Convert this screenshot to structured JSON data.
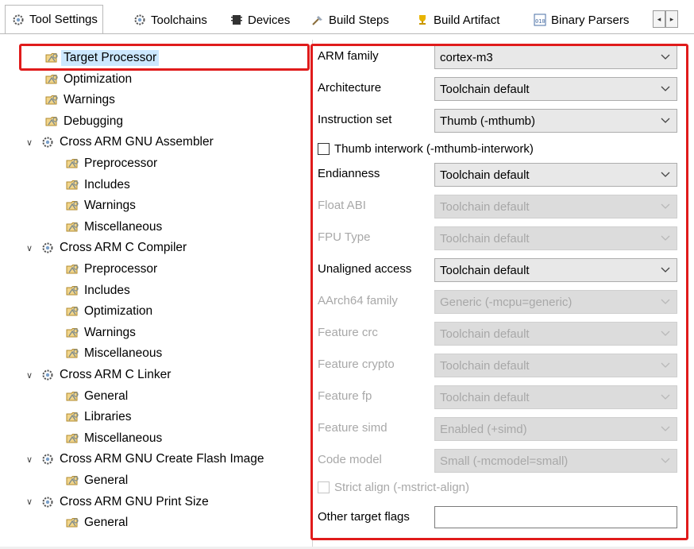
{
  "tabs": [
    {
      "label": "Tool Settings",
      "icon": "gear-icon",
      "active": true
    },
    {
      "label": "Toolchains",
      "icon": "gear-icon",
      "active": false
    },
    {
      "label": "Devices",
      "icon": "chip-icon",
      "active": false
    },
    {
      "label": "Build Steps",
      "icon": "build-steps-icon",
      "active": false
    },
    {
      "label": "Build Artifact",
      "icon": "trophy-icon",
      "active": false
    },
    {
      "label": "Binary Parsers",
      "icon": "binary-icon",
      "active": false
    }
  ],
  "tab_scroll": {
    "left": "◂",
    "right": "▸"
  },
  "tree": {
    "items": [
      {
        "label": "Target Processor",
        "level": 1,
        "type": "leaf",
        "selected": true
      },
      {
        "label": "Optimization",
        "level": 1,
        "type": "leaf"
      },
      {
        "label": "Warnings",
        "level": 1,
        "type": "leaf"
      },
      {
        "label": "Debugging",
        "level": 1,
        "type": "leaf"
      },
      {
        "label": "Cross ARM GNU Assembler",
        "level": 0,
        "type": "tool",
        "expanded": true
      },
      {
        "label": "Preprocessor",
        "level": 2,
        "type": "leaf"
      },
      {
        "label": "Includes",
        "level": 2,
        "type": "leaf"
      },
      {
        "label": "Warnings",
        "level": 2,
        "type": "leaf"
      },
      {
        "label": "Miscellaneous",
        "level": 2,
        "type": "leaf"
      },
      {
        "label": "Cross ARM C Compiler",
        "level": 0,
        "type": "tool",
        "expanded": true
      },
      {
        "label": "Preprocessor",
        "level": 2,
        "type": "leaf"
      },
      {
        "label": "Includes",
        "level": 2,
        "type": "leaf"
      },
      {
        "label": "Optimization",
        "level": 2,
        "type": "leaf"
      },
      {
        "label": "Warnings",
        "level": 2,
        "type": "leaf"
      },
      {
        "label": "Miscellaneous",
        "level": 2,
        "type": "leaf"
      },
      {
        "label": "Cross ARM C Linker",
        "level": 0,
        "type": "tool",
        "expanded": true
      },
      {
        "label": "General",
        "level": 2,
        "type": "leaf"
      },
      {
        "label": "Libraries",
        "level": 2,
        "type": "leaf"
      },
      {
        "label": "Miscellaneous",
        "level": 2,
        "type": "leaf"
      },
      {
        "label": "Cross ARM GNU Create Flash Image",
        "level": 0,
        "type": "tool",
        "expanded": true
      },
      {
        "label": "General",
        "level": 2,
        "type": "leaf"
      },
      {
        "label": "Cross ARM GNU Print Size",
        "level": 0,
        "type": "tool",
        "expanded": true
      },
      {
        "label": "General",
        "level": 2,
        "type": "leaf"
      }
    ]
  },
  "form": {
    "fields": [
      {
        "kind": "combo",
        "label": "ARM family",
        "value": "cortex-m3",
        "enabled": true
      },
      {
        "kind": "combo",
        "label": "Architecture",
        "value": "Toolchain default",
        "enabled": true
      },
      {
        "kind": "combo",
        "label": "Instruction set",
        "value": "Thumb (-mthumb)",
        "enabled": true
      },
      {
        "kind": "check",
        "label": "Thumb interwork (-mthumb-interwork)",
        "checked": false,
        "enabled": true
      },
      {
        "kind": "combo",
        "label": "Endianness",
        "value": "Toolchain default",
        "enabled": true
      },
      {
        "kind": "combo",
        "label": "Float ABI",
        "value": "Toolchain default",
        "enabled": false
      },
      {
        "kind": "combo",
        "label": "FPU Type",
        "value": "Toolchain default",
        "enabled": false
      },
      {
        "kind": "combo",
        "label": "Unaligned access",
        "value": "Toolchain default",
        "enabled": true
      },
      {
        "kind": "combo",
        "label": "AArch64 family",
        "value": "Generic (-mcpu=generic)",
        "enabled": false
      },
      {
        "kind": "combo",
        "label": "Feature crc",
        "value": "Toolchain default",
        "enabled": false
      },
      {
        "kind": "combo",
        "label": "Feature crypto",
        "value": "Toolchain default",
        "enabled": false
      },
      {
        "kind": "combo",
        "label": "Feature fp",
        "value": "Toolchain default",
        "enabled": false
      },
      {
        "kind": "combo",
        "label": "Feature simd",
        "value": "Enabled (+simd)",
        "enabled": false
      },
      {
        "kind": "combo",
        "label": "Code model",
        "value": "Small (-mcmodel=small)",
        "enabled": false
      },
      {
        "kind": "check",
        "label": "Strict align (-mstrict-align)",
        "checked": false,
        "enabled": false
      },
      {
        "kind": "text",
        "label": "Other target flags",
        "value": "",
        "enabled": true
      }
    ]
  },
  "colors": {
    "highlight_box": "#e01b1b",
    "selection": "#cce8ff",
    "disabled_text": "#a8a8a8"
  }
}
